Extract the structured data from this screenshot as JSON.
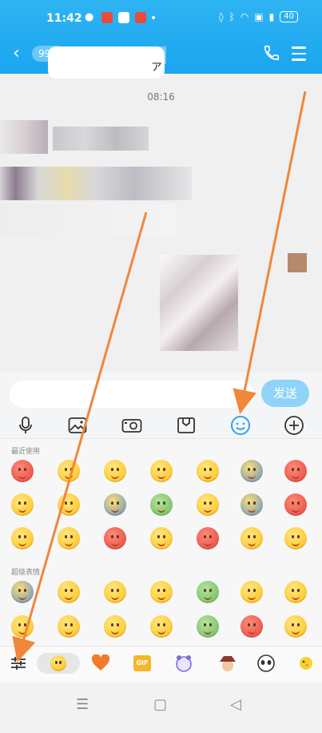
{
  "status_bar": {
    "time": "11:42",
    "battery": "40"
  },
  "header": {
    "back_icon": "chevron-left-icon",
    "unread_badge": "99+",
    "call_icon": "phone-icon",
    "menu_icon": "hamburger-menu-icon"
  },
  "chat": {
    "timestamp": "08:16",
    "bubble_fragment": "ァ"
  },
  "composer": {
    "send_label": "发送",
    "input_value": ""
  },
  "toolbar": {
    "items": [
      "microphone-icon",
      "image-icon",
      "camera-icon",
      "file-box-icon",
      "emoji-icon",
      "plus-icon"
    ],
    "active": "emoji-icon",
    "active_color": "#29a5f0"
  },
  "emoji_panel": {
    "recent_label": "最近使用",
    "super_label": "超级表情",
    "recent_count": 21,
    "super_count": 14
  },
  "emoji_tabs": {
    "items": [
      "settings-sliders-icon",
      "smiley-tab-icon",
      "heart-tab-icon",
      "gif-tab-icon",
      "character-tab-icon",
      "hat-character-tab-icon",
      "panda-tab-icon",
      "bird-tab-icon"
    ],
    "selected": "smiley-tab-icon"
  },
  "gif_label": "GIF",
  "nav": {
    "items": [
      "recents-icon",
      "home-icon",
      "back-triangle-icon"
    ]
  },
  "colors": {
    "header_blue": "#1aa5ef",
    "send_button": "#8fd3f9",
    "annotation_arrow": "#f0873a"
  }
}
